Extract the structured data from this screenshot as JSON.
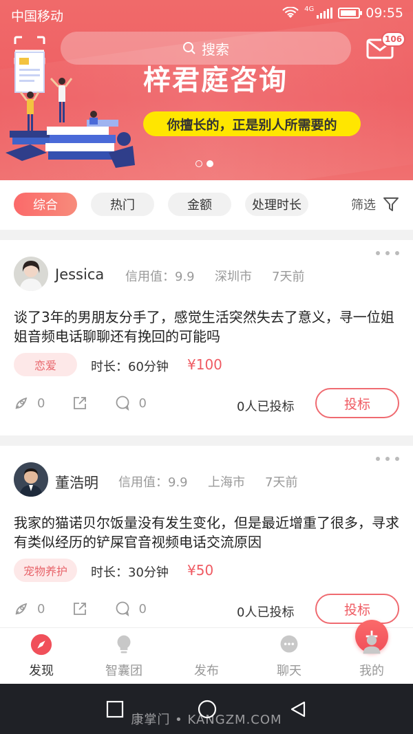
{
  "status_bar": {
    "carrier": "中国移动",
    "network": "4G",
    "time": "09:55"
  },
  "header": {
    "search_label": "搜索",
    "mail_badge": "106",
    "banner_title": "梓君庭咨询",
    "banner_slogan": "你擅长的，正是别人所需要的",
    "carousel_pages": 2,
    "carousel_active": 2
  },
  "filters": {
    "tabs": [
      {
        "label": "综合",
        "active": true
      },
      {
        "label": "热门",
        "active": false
      },
      {
        "label": "金额",
        "active": false
      },
      {
        "label": "处理时长",
        "active": false
      }
    ],
    "filter_label": "筛选"
  },
  "posts": [
    {
      "name": "Jessica",
      "credit": "信用值：9.9",
      "city": "深圳市",
      "time": "7天前",
      "content": "谈了3年的男朋友分手了，感觉生活突然失去了意义，寻一位姐姐音频电话聊聊还有挽回的可能吗",
      "tag": "恋爱",
      "duration": "时长：60分钟",
      "price": "¥100",
      "likes": "0",
      "comments": "0",
      "bids": "0人已投标",
      "bid_label": "投标"
    },
    {
      "name": "董浩明",
      "credit": "信用值：9.9",
      "city": "上海市",
      "time": "7天前",
      "content": "我家的猫诺贝尔饭量没有发生变化，但是最近增重了很多，寻求有类似经历的铲屎官音视频电话交流原因",
      "tag": "宠物养护",
      "duration": "时长：30分钟",
      "price": "¥50",
      "likes": "0",
      "comments": "0",
      "bids": "0人已投标",
      "bid_label": "投标"
    }
  ],
  "bottom_nav": [
    {
      "label": "发现",
      "icon": "compass-icon",
      "active": true
    },
    {
      "label": "智囊团",
      "icon": "bulb-icon",
      "active": false
    },
    {
      "label": "发布",
      "icon": "plus-icon",
      "active": false
    },
    {
      "label": "聊天",
      "icon": "chat-icon",
      "active": false
    },
    {
      "label": "我的",
      "icon": "user-icon",
      "active": false
    }
  ],
  "watermark": "康掌门 • KANGZM.COM",
  "colors": {
    "brand": "#ef5a62",
    "banner": "#ee5f63",
    "slogan_bg": "#ffe600"
  }
}
